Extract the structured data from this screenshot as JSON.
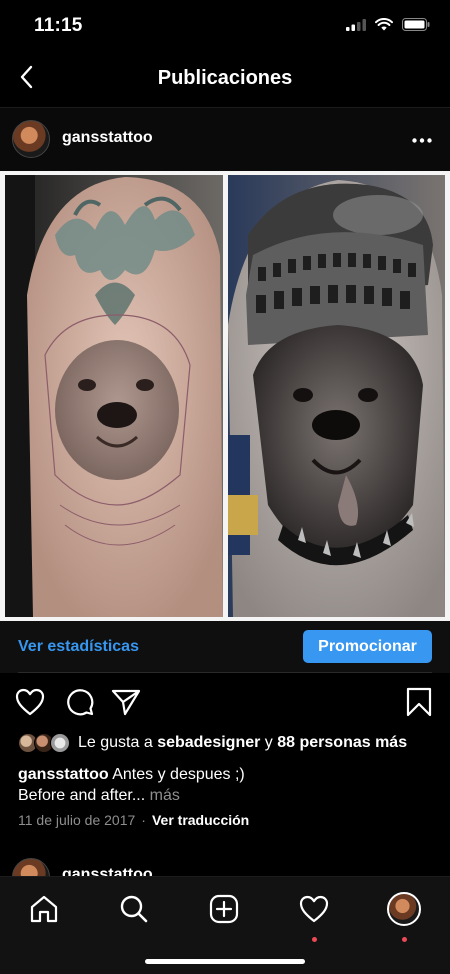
{
  "status_bar": {
    "time": "11:15"
  },
  "header": {
    "title": "Publicaciones"
  },
  "post": {
    "username": "gansstattoo",
    "insights_label": "Ver estadísticas",
    "promote_label": "Promocionar",
    "likes": {
      "prefix": "Le gusta a",
      "user": "sebadesigner",
      "conjunction": "y",
      "others": "88 personas más"
    },
    "caption": {
      "username": "gansstattoo",
      "line1": "Antes y despues ;)",
      "line2": "Before and after...",
      "more": "más"
    },
    "date": "11 de julio de 2017",
    "separator": "·",
    "translate_label": "Ver traducción"
  },
  "next_post": {
    "username": "gansstattoo"
  },
  "icons": {
    "back": "chevron-left-icon",
    "more": "ellipsis-icon",
    "like": "heart-icon",
    "comment": "comment-icon",
    "share": "paper-plane-icon",
    "save": "bookmark-icon",
    "home": "home-icon",
    "search": "search-icon",
    "create": "plus-square-icon",
    "activity": "heart-icon",
    "profile": "avatar"
  },
  "colors": {
    "accent": "#3897f0",
    "link": "#3797f0",
    "notification": "#ed4956",
    "background": "#000000"
  }
}
